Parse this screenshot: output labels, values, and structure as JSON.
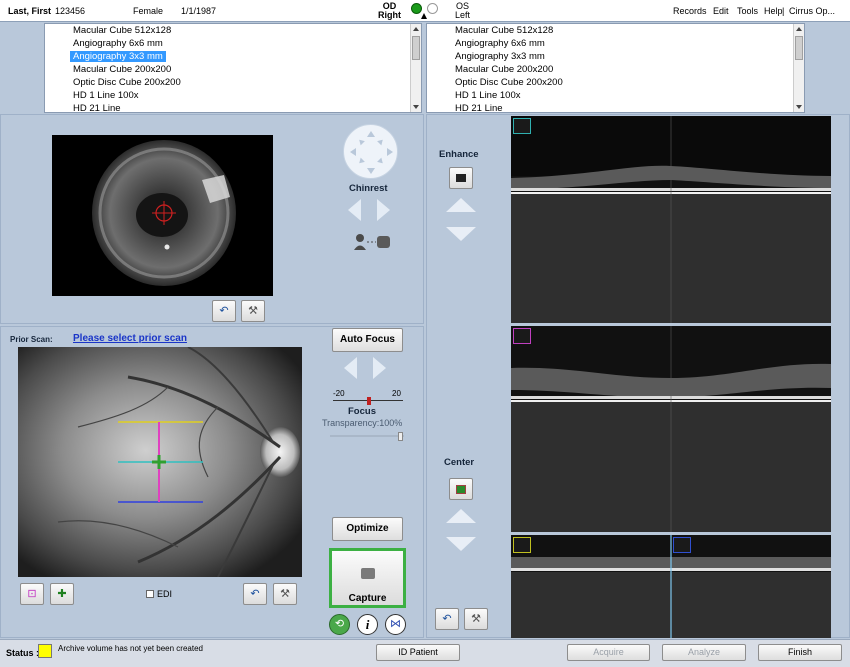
{
  "patient": {
    "name": "Last, First",
    "id": "123456",
    "sex": "Female",
    "dob": "1/1/1987"
  },
  "eye": {
    "od_label": "OD",
    "od_sub": "Right",
    "os_label": "OS",
    "os_sub": "Left"
  },
  "menu": {
    "records": "Records",
    "edit": "Edit",
    "tools": "Tools",
    "help": "Help",
    "app": "Cirrus Op..."
  },
  "scan_list_left": [
    {
      "label": "Macular Cube 512x128",
      "selected": false
    },
    {
      "label": "Angiography 6x6 mm",
      "selected": false
    },
    {
      "label": "Angiography 3x3 mm",
      "selected": true
    },
    {
      "label": "Macular Cube 200x200",
      "selected": false
    },
    {
      "label": "Optic Disc Cube 200x200",
      "selected": false
    },
    {
      "label": "HD 1 Line 100x",
      "selected": false
    },
    {
      "label": "HD 21 Line",
      "selected": false
    }
  ],
  "scan_list_right": [
    {
      "label": "Macular Cube 512x128"
    },
    {
      "label": "Angiography 6x6 mm"
    },
    {
      "label": "Angiography 3x3 mm"
    },
    {
      "label": "Macular Cube 200x200"
    },
    {
      "label": "Optic Disc Cube 200x200"
    },
    {
      "label": "HD 1 Line 100x"
    },
    {
      "label": "HD 21 Line"
    }
  ],
  "chinrest": {
    "label": "Chinrest"
  },
  "prior_scan": {
    "label": "Prior Scan:",
    "link": "Please select prior scan"
  },
  "focus": {
    "auto_focus": "Auto Focus",
    "min": "-20",
    "max": "20",
    "label": "Focus",
    "transparency": "Transparency:100%"
  },
  "optimize": "Optimize",
  "capture": "Capture",
  "edi": "EDI",
  "enhance": "Enhance",
  "center": "Center",
  "status": {
    "label": "Status :",
    "message": "Archive volume has not yet been created",
    "indicator_color": "#ffff00"
  },
  "buttons": {
    "id_patient": "ID Patient",
    "acquire": "Acquire",
    "analyze": "Analyze",
    "finish": "Finish"
  },
  "colors": {
    "selection": "#3399ff",
    "capture_border": "#3cb043",
    "od_indicator": "#1a9a1a"
  }
}
